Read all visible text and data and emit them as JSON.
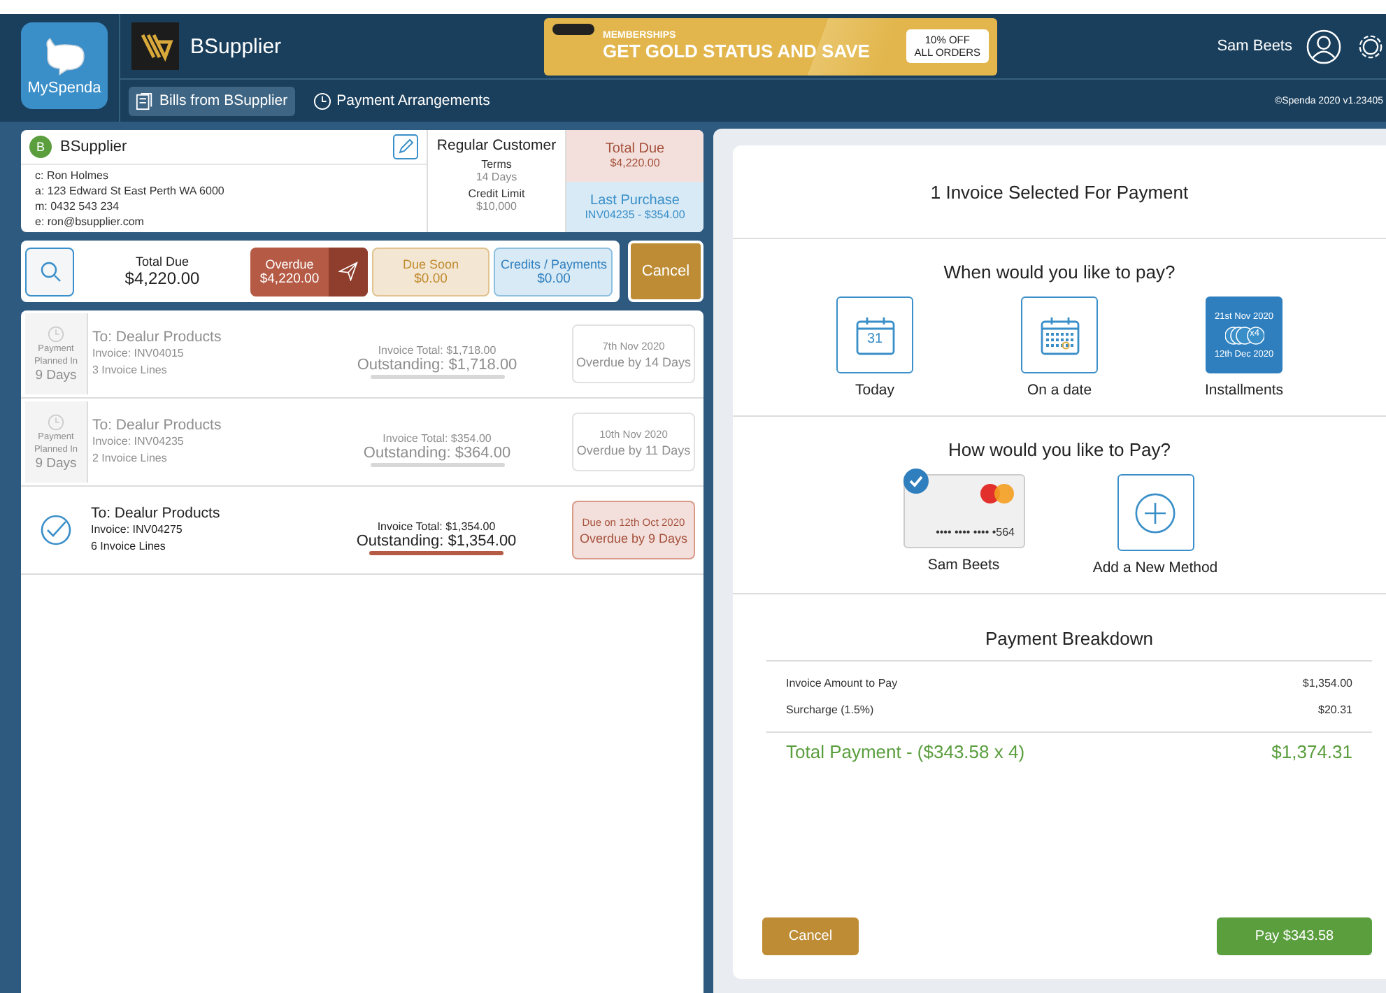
{
  "header": {
    "app_name": "MySpenda",
    "supplier": "BSupplier",
    "nav": [
      {
        "label": "Bills from BSupplier",
        "kind": "bills",
        "selected": true
      },
      {
        "label": "Payment Arrangements",
        "kind": "clock",
        "selected": false
      }
    ],
    "promo": {
      "kicker": "MEMBERSHIPS",
      "headline": "GET GOLD STATUS AND SAVE",
      "badge_lines": [
        "10% OFF",
        "ALL ORDERS"
      ]
    },
    "user": "Sam Beets",
    "version": "©Spenda 2020 v1.23405"
  },
  "supplier_card": {
    "initial": "B",
    "name": "BSupplier",
    "contact": [
      "c: Ron Holmes",
      "a: 123 Edward St East Perth WA 6000",
      "m: 0432 543 234",
      "e: ron@bsupplier.com"
    ],
    "customer_type": "Regular Customer",
    "terms_label": "Terms",
    "terms": "14 Days",
    "credit_label": "Credit Limit",
    "credit": "$10,000",
    "total_due": {
      "label": "Total Due",
      "value": "$4,220.00"
    },
    "last_purchase": {
      "label": "Last Purchase",
      "value": "INV04235 - $354.00"
    }
  },
  "summary": {
    "total_label": "Total Due",
    "total": "$4,220.00",
    "tiles": [
      {
        "kind": "overdue",
        "label": "Overdue",
        "value": "$4,220.00"
      },
      {
        "kind": "soon",
        "label": "Due Soon",
        "value": "$0.00"
      },
      {
        "kind": "credits",
        "label": "Credits / Payments",
        "value": "$0.00"
      }
    ],
    "cancel": "Cancel"
  },
  "invoices": [
    {
      "planned": {
        "label": "Payment Planned In",
        "days": "9 Days"
      },
      "selected": false,
      "to": "To: Dealur Products",
      "invoice": "Invoice: INV04015",
      "lines": "3 Invoice Lines",
      "invoice_total": "Invoice Total: $1,718.00",
      "outstanding": "Outstanding: $1,718.00",
      "date": "7th Nov 2020",
      "status": "Overdue by 14 Days"
    },
    {
      "planned": {
        "label": "Payment Planned In",
        "days": "9 Days"
      },
      "selected": false,
      "to": "To: Dealur Products",
      "invoice": "Invoice: INV04235",
      "lines": "2 Invoice Lines",
      "invoice_total": "Invoice Total: $354.00",
      "outstanding": "Outstanding: $364.00",
      "date": "10th Nov 2020",
      "status": "Overdue by 11 Days"
    },
    {
      "selected": true,
      "to": "To: Dealur Products",
      "invoice": "Invoice: INV04275",
      "lines": "6 Invoice Lines",
      "invoice_total": "Invoice Total: $1,354.00",
      "outstanding": "Outstanding: $1,354.00",
      "date": "Due on 12th Oct 2020",
      "status": "Overdue by 9 Days"
    }
  ],
  "payment": {
    "title": "1 Invoice Selected For Payment",
    "when_title": "When would you like to pay?",
    "when_options": [
      {
        "kind": "today",
        "label": "Today",
        "day": "31",
        "selected": false
      },
      {
        "kind": "date",
        "label": "On a date",
        "selected": false
      },
      {
        "kind": "installments",
        "label": "Installments",
        "start": "21st Nov 2020",
        "count": "x4",
        "end": "12th Dec 2020",
        "selected": true
      }
    ],
    "method_title": "How would you like to Pay?",
    "methods": [
      {
        "kind": "card",
        "label": "Sam Beets",
        "number": "•••• •••• •••• •564",
        "selected": true
      },
      {
        "kind": "add",
        "label": "Add a New Method",
        "selected": false
      }
    ],
    "breakdown_title": "Payment Breakdown",
    "rows": [
      {
        "label": "Invoice Amount to Pay",
        "value": "$1,354.00"
      },
      {
        "label": "Surcharge (1.5%)",
        "value": "$20.31"
      }
    ],
    "total_label": "Total Payment - ($343.58 x 4)",
    "total": "$1,374.31",
    "cancel": "Cancel",
    "pay": "Pay $343.58"
  }
}
